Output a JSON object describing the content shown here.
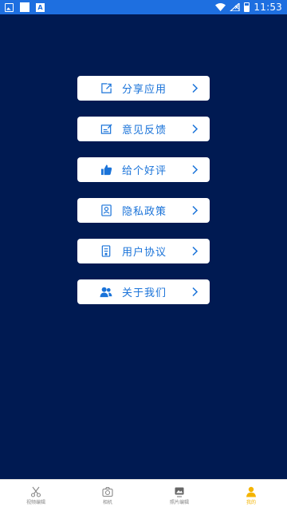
{
  "status_bar": {
    "time": "11:53"
  },
  "menu": [
    {
      "label": "分享应用",
      "icon": "share-icon"
    },
    {
      "label": "意见反馈",
      "icon": "feedback-icon"
    },
    {
      "label": "给个好评",
      "icon": "thumbs-up-icon"
    },
    {
      "label": "隐私政策",
      "icon": "privacy-icon"
    },
    {
      "label": "用户协议",
      "icon": "agreement-icon"
    },
    {
      "label": "关于我们",
      "icon": "about-us-icon"
    }
  ],
  "tabbar": [
    {
      "label": "视频编辑",
      "icon": "scissors-icon",
      "active": false
    },
    {
      "label": "相机",
      "icon": "camera-icon",
      "active": false
    },
    {
      "label": "照片编辑",
      "icon": "photo-edit-icon",
      "active": false
    },
    {
      "label": "我的",
      "icon": "profile-icon",
      "active": true
    }
  ],
  "colors": {
    "background": "#001a52",
    "status_bar": "#1e6fe0",
    "accent": "#1a73d9",
    "active_tab": "#f4b400"
  }
}
